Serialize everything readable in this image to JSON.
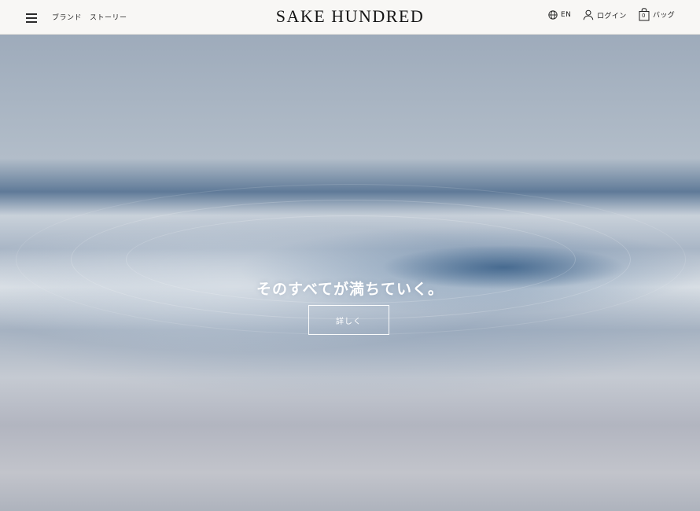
{
  "header": {
    "nav": [
      "ブランド",
      "ストーリー"
    ],
    "logo": "SAKE HUNDRED",
    "language": "EN",
    "login": "ログイン",
    "bag_count": "0",
    "bag": "バッグ"
  },
  "hero": {
    "title": "そのすべてが満ちていく。",
    "button_label": "詳しく"
  },
  "icons": {
    "menu": "hamburger-menu-icon",
    "language": "globe-icon",
    "login": "user-icon",
    "bag": "shopping-bag-icon"
  }
}
